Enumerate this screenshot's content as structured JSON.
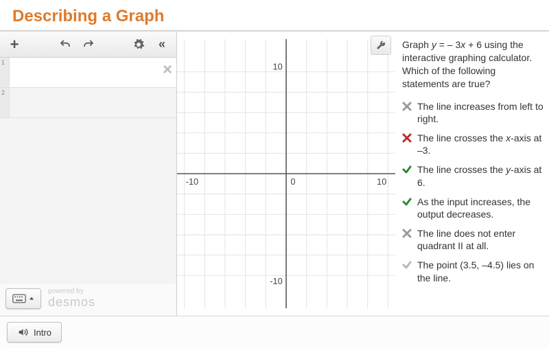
{
  "title": "Describing a Graph",
  "toolbar": {
    "add": "+",
    "undo": "undo",
    "redo": "redo",
    "settings": "settings",
    "collapse": "«"
  },
  "rows": [
    {
      "num": "1",
      "active": true
    },
    {
      "num": "2",
      "active": false
    }
  ],
  "desmos": {
    "powered": "powered by",
    "name": "desmos"
  },
  "graph": {
    "ticks": {
      "neg10": "-10",
      "pos10": "10",
      "zero": "0"
    }
  },
  "prompt": {
    "p1": "Graph ",
    "eq_lhs": "y",
    "eq_mid": " = – 3",
    "eq_x": "x",
    "eq_rhs": " + 6 using the interactive graphing calculator. Which of the following statements are true?"
  },
  "statements": [
    {
      "mark": "x-grey",
      "text": "The line increases from left to right."
    },
    {
      "mark": "x-red",
      "html": [
        "The line crosses the ",
        {
          "i": "x"
        },
        "-axis at –3."
      ]
    },
    {
      "mark": "check",
      "html": [
        "The line crosses the ",
        {
          "i": "y"
        },
        "-axis at 6."
      ]
    },
    {
      "mark": "check",
      "text": "As the input increases, the output decreases."
    },
    {
      "mark": "x-grey",
      "text": "The line does not enter quadrant II at all."
    },
    {
      "mark": "check-grey",
      "text": "The point (3.5, –4.5) lies on the line."
    }
  ],
  "intro": "Intro",
  "chart_data": {
    "type": "line",
    "title": "",
    "xlabel": "",
    "ylabel": "",
    "xlim": [
      -10,
      10
    ],
    "ylim": [
      -10,
      10
    ],
    "x_ticks": [
      -10,
      0,
      10
    ],
    "y_ticks": [
      -10,
      0,
      10
    ],
    "grid": true,
    "series": []
  }
}
